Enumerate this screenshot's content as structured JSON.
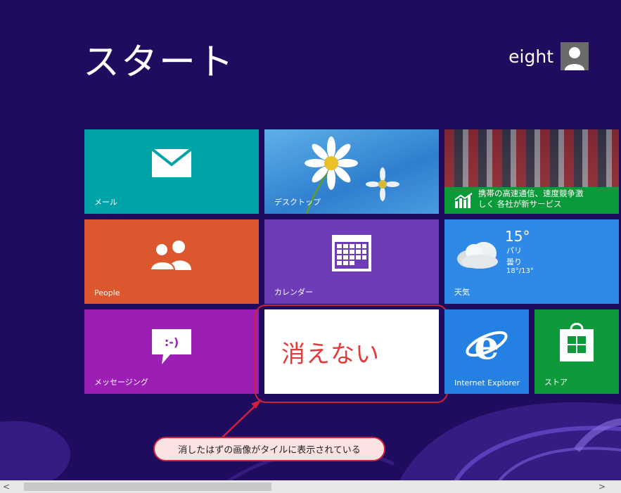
{
  "header": {
    "title": "スタート",
    "user_name": "eight"
  },
  "tiles": {
    "mail": {
      "label": "メール",
      "icon": "mail-icon"
    },
    "desktop": {
      "label": "デスクトップ"
    },
    "news": {
      "headline_line1": "携帯の高速通信、速度競争激",
      "headline_line2": "しく 各社が新サービス",
      "icon": "chart-icon"
    },
    "people": {
      "label": "People",
      "icon": "people-icon"
    },
    "calendar": {
      "label": "カレンダー",
      "icon": "calendar-icon"
    },
    "weather": {
      "label": "天気",
      "temp": "15°",
      "city": "パリ",
      "condition": "曇り",
      "range": "18°/13°",
      "icon": "cloud-icon"
    },
    "messaging": {
      "label": "メッセージング",
      "icon": "message-icon",
      "glyph": ":-)"
    },
    "ghost": {
      "text": "消えない"
    },
    "ie": {
      "label": "Internet Explorer",
      "icon": "ie-icon"
    },
    "store": {
      "label": "ストア",
      "icon": "store-icon"
    }
  },
  "annotation": {
    "callout": "消したはずの画像がタイルに表示されている"
  },
  "scrollbar": {
    "left_arrow": "<",
    "right_arrow": ">"
  },
  "colors": {
    "background": "#1f0c5e",
    "accent": "#d1213a"
  }
}
